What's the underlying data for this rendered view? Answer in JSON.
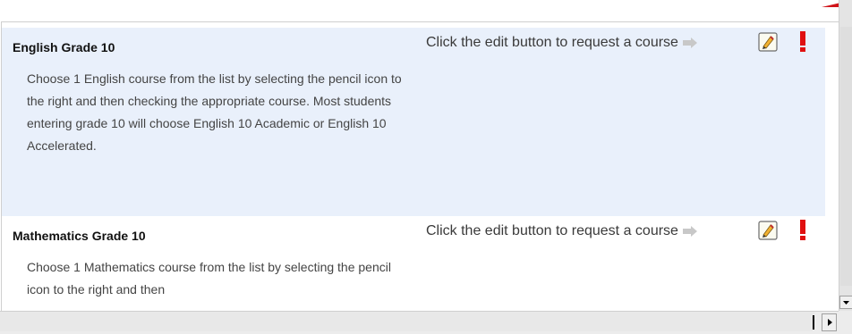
{
  "courses": [
    {
      "title": "English Grade 10",
      "description": "Choose 1 English course from the list by selecting the pencil icon to the right and then checking the appropriate course. Most students entering grade 10 will choose English 10 Academic or English 10 Accelerated.",
      "action_text": "Click the edit button to request a course",
      "alert": "!"
    },
    {
      "title": "Mathematics Grade 10",
      "description": "Choose 1 Mathematics course from the list by selecting the pencil icon to the right and then",
      "action_text": "Click the edit button to request a course",
      "alert": "!"
    }
  ],
  "icons": {
    "arrow": "right-arrow-icon",
    "edit": "pencil-edit-icon",
    "alert": "exclamation-icon"
  },
  "colors": {
    "shaded_row": "#e9f0fb",
    "alert_red": "#e01010",
    "arrow_gray": "#c8c8c8"
  }
}
